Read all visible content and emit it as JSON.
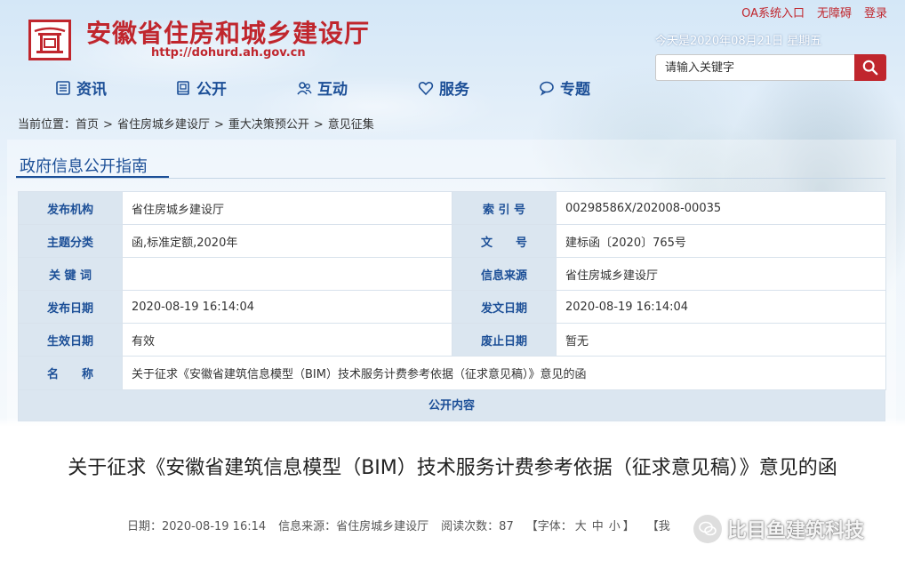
{
  "header": {
    "site_title": "安徽省住房和城乡建设厅",
    "site_url": "http://dohurd.ah.gov.cn",
    "top_links": [
      "OA系统入口",
      "无障碍",
      "登录"
    ],
    "today": "今天是2020年08月21日 星期五",
    "search": {
      "placeholder": "请输入关键字"
    }
  },
  "nav": [
    {
      "label": "资讯",
      "icon": "list-icon"
    },
    {
      "label": "公开",
      "icon": "book-icon"
    },
    {
      "label": "互动",
      "icon": "people-icon"
    },
    {
      "label": "服务",
      "icon": "heart-icon"
    },
    {
      "label": "专题",
      "icon": "chat-bubble-icon"
    }
  ],
  "breadcrumb": {
    "prefix": "当前位置：",
    "items": [
      "首页",
      "省住房城乡建设厅",
      "重大决策预公开",
      "意见征集"
    ],
    "separator": ">"
  },
  "panel": {
    "title": "政府信息公开指南",
    "rows": [
      {
        "l1": "发布机构",
        "v1": "省住房城乡建设厅",
        "l2": "索 引 号",
        "v2": "00298586X/202008-00035"
      },
      {
        "l1": "主题分类",
        "v1": "函,标准定额,2020年",
        "l2": "文　　号",
        "v2": "建标函〔2020〕765号"
      },
      {
        "l1": "关 键 词",
        "v1": "",
        "l2": "信息来源",
        "v2": "省住房城乡建设厅"
      },
      {
        "l1": "发布日期",
        "v1": "2020-08-19 16:14:04",
        "l2": "发文日期",
        "v2": "2020-08-19 16:14:04"
      },
      {
        "l1": "生效日期",
        "v1": "有效",
        "l2": "废止日期",
        "v2": "暂无"
      }
    ],
    "name_label": "名　　称",
    "name_value": "关于征求《安徽省建筑信息模型（BIM）技术服务计费参考依据（征求意见稿）》意见的函",
    "public_content": "公开内容"
  },
  "article": {
    "title": "关于征求《安徽省建筑信息模型（BIM）技术服务计费参考依据（征求意见稿）》意见的函",
    "date": "日期：2020-08-19 16:14",
    "source": "信息来源：省住房城乡建设厅",
    "views": "阅读次数：87",
    "font_label": "【字体：",
    "font_sizes": [
      "大",
      "中",
      "小"
    ],
    "font_close": "】",
    "extra": "【我"
  },
  "watermark": {
    "text": "比目鱼建筑科技"
  },
  "colors": {
    "brand_red": "#c0262d",
    "nav_blue": "#1c4f97",
    "label_bg": "#dbe6f0"
  }
}
